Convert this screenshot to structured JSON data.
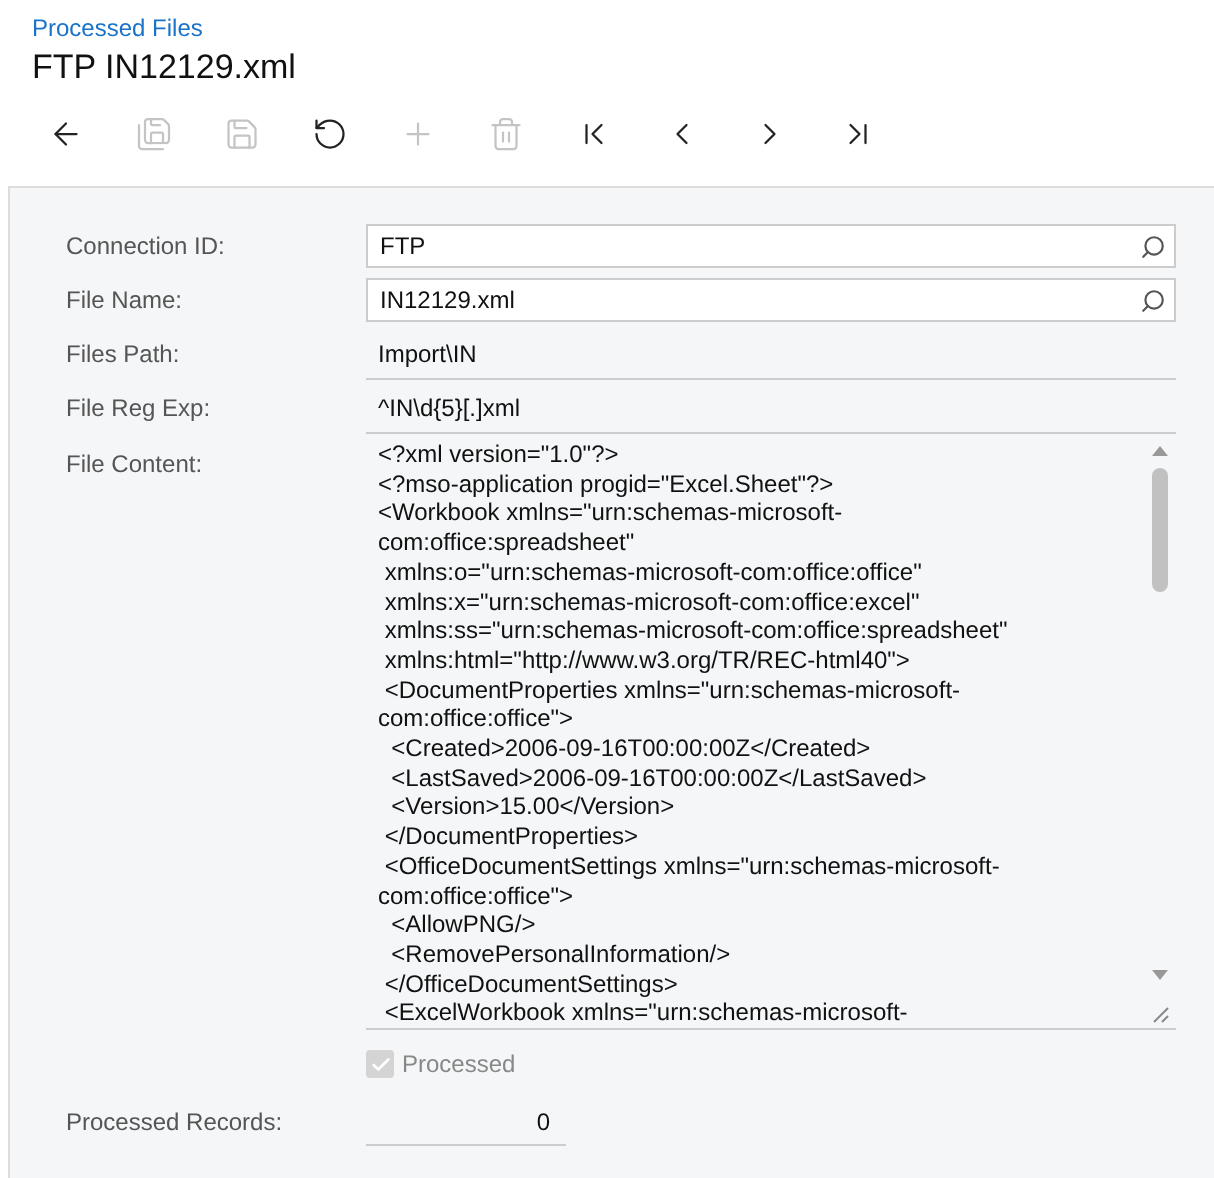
{
  "breadcrumb": "Processed Files",
  "title": "FTP IN12129.xml",
  "toolbar": [
    {
      "kind": "back",
      "disabled": false
    },
    {
      "kind": "save-close",
      "disabled": true
    },
    {
      "kind": "save",
      "disabled": true
    },
    {
      "kind": "undo",
      "disabled": false
    },
    {
      "kind": "add",
      "disabled": true
    },
    {
      "kind": "delete",
      "disabled": true
    },
    {
      "kind": "first",
      "disabled": false
    },
    {
      "kind": "previous",
      "disabled": false
    },
    {
      "kind": "next",
      "disabled": false
    },
    {
      "kind": "last",
      "disabled": false
    }
  ],
  "fields": [
    {
      "kind": "lookup",
      "label": "Connection ID:",
      "value": "FTP"
    },
    {
      "kind": "lookup",
      "label": "File Name:",
      "value": "IN12129.xml"
    },
    {
      "kind": "readonly",
      "label": "Files Path:",
      "value": "Import\\IN"
    },
    {
      "kind": "readonly",
      "label": "File Reg Exp:",
      "value": "^IN\\d{5}[.]xml"
    }
  ],
  "file_content": {
    "label": "File Content:",
    "lines": [
      "<?xml version=\"1.0\"?>",
      "<?mso-application progid=\"Excel.Sheet\"?>",
      "<Workbook xmlns=\"urn:schemas-microsoft-",
      "com:office:spreadsheet\"",
      " xmlns:o=\"urn:schemas-microsoft-com:office:office\"",
      " xmlns:x=\"urn:schemas-microsoft-com:office:excel\"",
      " xmlns:ss=\"urn:schemas-microsoft-com:office:spreadsheet\"",
      " xmlns:html=\"http://www.w3.org/TR/REC-html40\">",
      " <DocumentProperties xmlns=\"urn:schemas-microsoft-",
      "com:office:office\">",
      "  <Created>2006-09-16T00:00:00Z</Created>",
      "  <LastSaved>2006-09-16T00:00:00Z</LastSaved>",
      "  <Version>15.00</Version>",
      " </DocumentProperties>",
      " <OfficeDocumentSettings xmlns=\"urn:schemas-microsoft-",
      "com:office:office\">",
      "  <AllowPNG/>",
      "  <RemovePersonalInformation/>",
      " </OfficeDocumentSettings>",
      " <ExcelWorkbook xmlns=\"urn:schemas-microsoft-"
    ]
  },
  "processed": {
    "label": "Processed",
    "checked": true,
    "disabled": true
  },
  "processed_records": {
    "label": "Processed Records:",
    "value": "0"
  }
}
